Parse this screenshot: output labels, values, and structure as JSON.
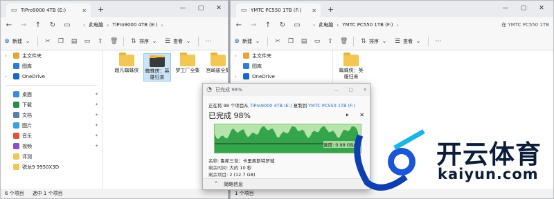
{
  "left_window": {
    "tab_title": "TiPro9000 4TB (E:)",
    "breadcrumbs": [
      "此电脑",
      "TiPro9000 4TB (E:)"
    ],
    "toolbar": {
      "new": "新建",
      "sort": "排序",
      "view": "查看"
    },
    "sidebar": [
      {
        "label": "主文件夹",
        "icon": "home-icon",
        "color": "#e8a33a"
      },
      {
        "label": "图库",
        "icon": "gallery-icon",
        "color": "#2f7bd6"
      },
      {
        "label": "OneDrive",
        "icon": "cloud-icon",
        "color": "#1a67c9"
      },
      {
        "label": "桌面",
        "icon": "desktop-icon",
        "color": "#3d8be0"
      },
      {
        "label": "下载",
        "icon": "download-icon",
        "color": "#2a8a4a"
      },
      {
        "label": "文档",
        "icon": "document-icon",
        "color": "#5a7ea8"
      },
      {
        "label": "图片",
        "icon": "pictures-icon",
        "color": "#3aa1e0"
      },
      {
        "label": "音乐",
        "icon": "music-icon",
        "color": "#e0533a"
      },
      {
        "label": "视频",
        "icon": "video-icon",
        "color": "#8a4fcf"
      },
      {
        "label": "评测",
        "icon": "folder-icon",
        "color": "#f4c653"
      },
      {
        "label": "锐龙9 9950X3D",
        "icon": "folder-icon",
        "color": "#f4c653"
      }
    ],
    "files": [
      {
        "name": "超凡蜘蛛侠",
        "selected": false
      },
      {
        "name": "蜘蛛侠：英雄归来",
        "selected": true
      },
      {
        "name": "梦工厂全集",
        "selected": false
      },
      {
        "name": "宫崎骏全集",
        "selected": false
      }
    ],
    "status": {
      "count": "6 个项目",
      "selected": "选中 1 个项目"
    }
  },
  "right_window": {
    "tab_title": "YMTC PC550 1TB (F:)",
    "breadcrumbs": [
      "此电脑",
      "YMTC PC550 1TB (F:)"
    ],
    "search_placeholder": "在 YMTC PC550 1TB",
    "toolbar": {
      "new": "新建",
      "sort": "排序",
      "view": "查看"
    },
    "sidebar": [
      {
        "label": "主文件夹",
        "icon": "home-icon",
        "color": "#e8a33a"
      },
      {
        "label": "图库",
        "icon": "gallery-icon",
        "color": "#2f7bd6"
      },
      {
        "label": "OneDrive",
        "icon": "cloud-icon",
        "color": "#1a67c9"
      }
    ],
    "files": [
      {
        "name": "蜘蛛侠：英雄归来",
        "selected": false
      }
    ],
    "status": {
      "count": "1 个项目"
    }
  },
  "dialog": {
    "title": "已完成 98%",
    "from_prefix": "正在将 98 个项目从",
    "from_src": "TiPro9000 4TB (E:)",
    "from_mid": "复制到",
    "from_dst": "YMTC PC550 1TB (F:)",
    "percent_text": "已完成 98%",
    "progress": 0.98,
    "speed": "速度: 0.98 GB/秒",
    "name_label": "名称:",
    "name_value": "鲁邦三世：卡里奥斯特罗城",
    "time_label": "剩余时间:",
    "time_value": "大约 10 秒",
    "items_label": "剩余项目:",
    "items_value": "2 (12.7 GB)",
    "less_info": "简略信息"
  },
  "watermark": {
    "brand_cn": "开云体育",
    "brand_en": "kaiyun.com"
  }
}
